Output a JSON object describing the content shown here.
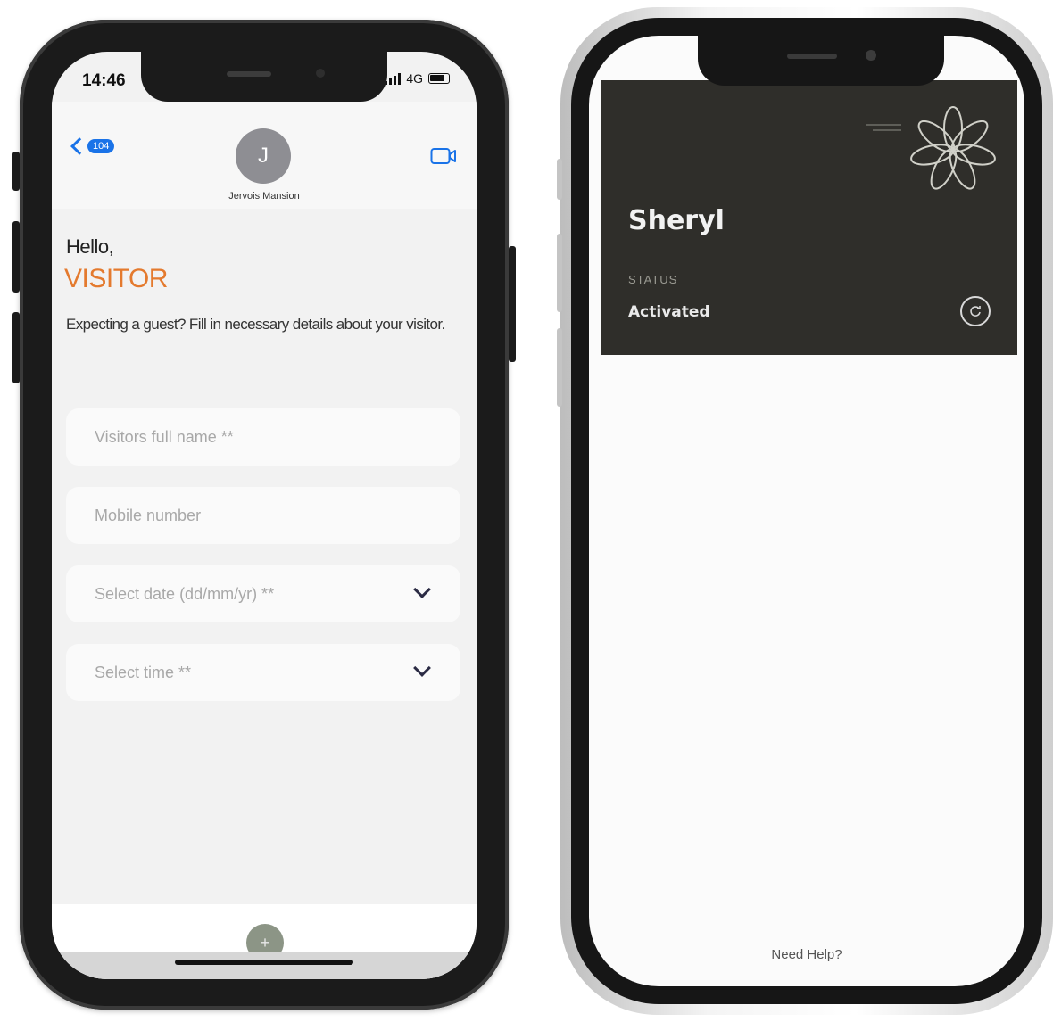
{
  "left_phone": {
    "status_bar": {
      "time": "14:46",
      "network": "4G"
    },
    "header": {
      "back_badge": "104",
      "avatar_initial": "J",
      "contact_name": "Jervois Mansion"
    },
    "content": {
      "greeting": "Hello,",
      "title": "VISITOR",
      "description": "Expecting a guest? Fill in necessary details about your visitor.",
      "fields": {
        "name_placeholder": "Visitors full name **",
        "mobile_placeholder": "Mobile number",
        "date_placeholder": "Select date (dd/mm/yr) **",
        "time_placeholder": "Select time **"
      }
    },
    "colors": {
      "accent": "#e47a2e",
      "ios_blue": "#1a73e8"
    }
  },
  "right_phone": {
    "card": {
      "name": "Sheryl",
      "status_label": "STATUS",
      "status_value": "Activated",
      "background": "#2f2e2a"
    },
    "footer": {
      "help_link": "Need Help?"
    }
  }
}
